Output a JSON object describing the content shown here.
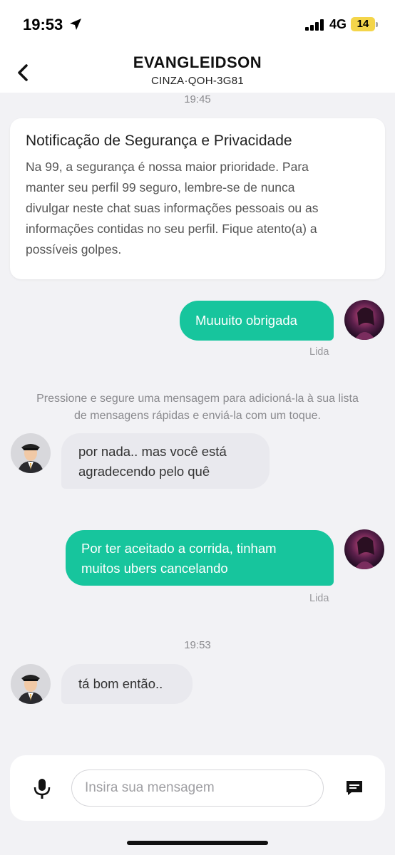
{
  "status_bar": {
    "time": "19:53",
    "network": "4G",
    "battery": "14",
    "battery_color": "#f4d54a"
  },
  "header": {
    "title": "EVANGLEIDSON",
    "subtitle": "CINZA·QOH-3G81"
  },
  "chat": {
    "timestamp_1": "19:45",
    "notice": {
      "title": "Notificação de Segurança e Privacidade",
      "line_1": "Na 99, a segurança é nossa maior prioridade. Para",
      "line_2": "manter seu perfil 99 seguro, lembre-se de nunca",
      "line_3": "divulgar neste chat suas informações pessoais ou as",
      "line_4": "informações contidas no seu perfil. Fique atento(a) a",
      "line_5": "possíveis golpes."
    },
    "msg_1": {
      "text": "Muuuito obrigada",
      "status": "Lida"
    },
    "hint_line_1": "Pressione e segure uma mensagem para adicioná-la à sua lista",
    "hint_line_2": "de mensagens rápidas e enviá-la com um toque.",
    "msg_2": {
      "line_1": "por nada.. mas você está",
      "line_2": "agradecendo pelo quê"
    },
    "msg_3": {
      "line_1": "Por ter aceitado a corrida, tinham",
      "line_2": "muitos ubers cancelando",
      "status": "Lida"
    },
    "timestamp_2": "19:53",
    "msg_4": {
      "text": "tá bom então.."
    }
  },
  "composer": {
    "placeholder": "Insira sua mensagem",
    "mic_icon": "microphone-icon",
    "quick_icon": "quick-message-icon"
  },
  "colors": {
    "outgoing_bubble": "#17c59d",
    "incoming_bubble": "#e9e9ee",
    "background": "#f2f2f5"
  }
}
